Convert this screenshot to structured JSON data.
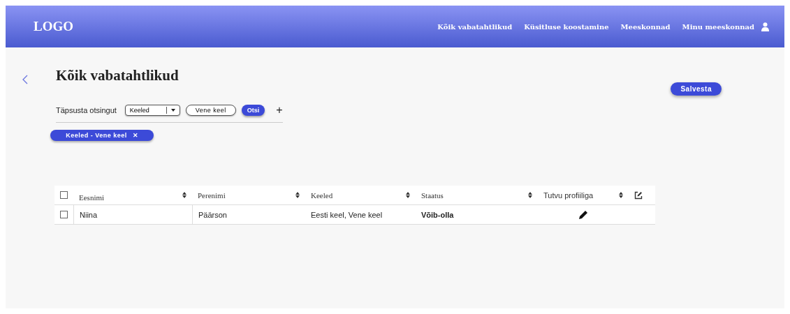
{
  "header": {
    "logo": "LOGO",
    "nav": [
      "Kõik vabatahtlikud",
      "Küsitluse koostamine",
      "Meeskonnad",
      "Minu meeskonnad"
    ]
  },
  "page": {
    "title": "Kõik vabatahtlikud",
    "save_button": "Salvesta"
  },
  "filter": {
    "label": "Täpsusta otsingut",
    "select": "Keeled",
    "field_value": "Vene keel",
    "search_button": "Otsi",
    "add_button": "+"
  },
  "chips": [
    {
      "label": "Keeled - Vene keel",
      "remove": "✕"
    }
  ],
  "table": {
    "columns": [
      {
        "label": "Eesnimi",
        "kind": "text"
      },
      {
        "label": "Perenimi",
        "kind": "text"
      },
      {
        "label": "Keeled",
        "kind": "text"
      },
      {
        "label": "Staatus",
        "kind": "text"
      },
      {
        "label": "Tutvu profiiliga",
        "kind": "action"
      }
    ],
    "header_checked": false,
    "rows": [
      {
        "checked": false,
        "cells": [
          "Niina",
          "Päärson",
          "Eesti keel, Vene keel",
          "Võib-olla"
        ]
      }
    ]
  }
}
